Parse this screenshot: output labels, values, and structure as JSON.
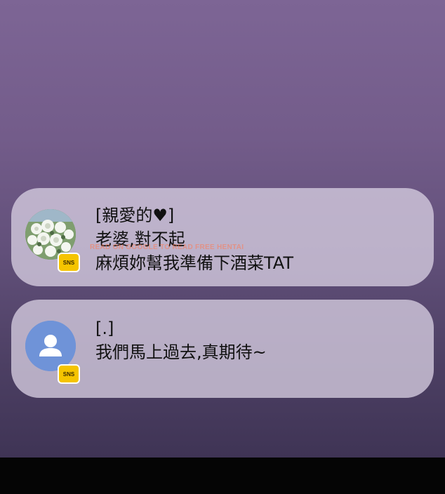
{
  "notifications": [
    {
      "sender": "[親愛的♥]",
      "lines": [
        "老婆,對不起",
        "麻煩妳幫我準備下酒菜TAT"
      ],
      "avatar": "flower-bouquet-avatar",
      "badge": "SNS"
    },
    {
      "sender": "[.]",
      "lines": [
        "我們馬上過去,真期待~"
      ],
      "avatar": "default-person-avatar",
      "badge": "SNS"
    }
  ],
  "watermark": "READ ON GOOGLE TO READ FREE HENTAI",
  "colors": {
    "background_top": "#7d6595",
    "background_bottom": "#3f3455",
    "notification_bg": "#d6cde0",
    "badge": "#f5c400",
    "person_avatar": "#6f93d8"
  }
}
